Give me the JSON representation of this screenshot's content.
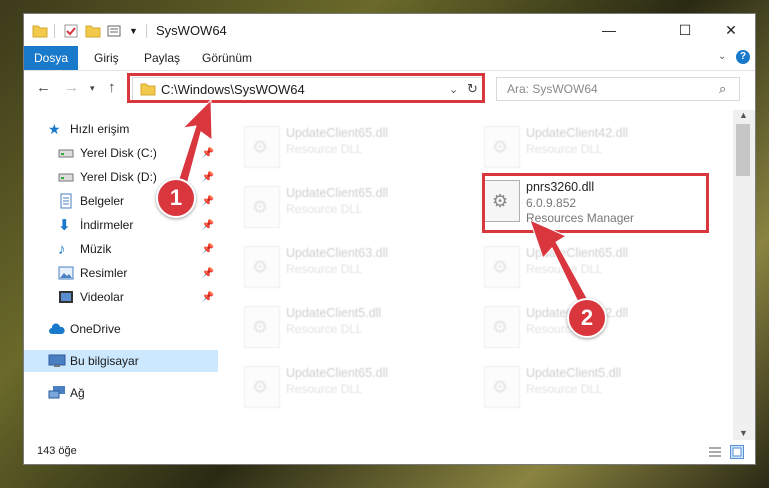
{
  "window": {
    "title": "SysWOW64",
    "controls": {
      "minimize": "—",
      "maximize": "☐",
      "close": "✕"
    }
  },
  "ribbon": {
    "tabs": [
      {
        "label": "Dosya",
        "active": true
      },
      {
        "label": "Giriş"
      },
      {
        "label": "Paylaş"
      },
      {
        "label": "Görünüm"
      }
    ]
  },
  "address": {
    "path": "C:\\Windows\\SysWOW64",
    "search_placeholder": "Ara: SysWOW64"
  },
  "navpane": {
    "items": [
      {
        "label": "Hızlı erişim",
        "icon": "star-icon"
      },
      {
        "label": "Yerel Disk (C:)",
        "icon": "drive-icon",
        "pinned": true
      },
      {
        "label": "Yerel Disk (D:)",
        "icon": "drive-icon",
        "pinned": true
      },
      {
        "label": "Belgeler",
        "icon": "documents-icon",
        "pinned": true
      },
      {
        "label": "İndirmeler",
        "icon": "download-icon",
        "pinned": true
      },
      {
        "label": "Müzik",
        "icon": "music-icon",
        "pinned": true
      },
      {
        "label": "Resimler",
        "icon": "pictures-icon",
        "pinned": true
      },
      {
        "label": "Videolar",
        "icon": "videos-icon",
        "pinned": true
      },
      {
        "label": "OneDrive",
        "icon": "cloud-icon"
      },
      {
        "label": "Bu bilgisayar",
        "icon": "computer-icon",
        "selected": true
      },
      {
        "label": "Ağ",
        "icon": "network-icon"
      }
    ]
  },
  "files": [
    {
      "name": "UpdateClient65.dll",
      "sub1": "Resource DLL",
      "faded": true
    },
    {
      "name": "UpdateClient42.dll",
      "sub1": "Resource DLL",
      "faded": true
    },
    {
      "name": "UpdateClient65.dll",
      "sub1": "Resource DLL",
      "faded": true
    },
    {
      "name": "pnrs3260.dll",
      "sub1": "6.0.9.852",
      "sub2": "Resources Manager",
      "faded": false
    },
    {
      "name": "UpdateClient63.dll",
      "sub1": "Resource DLL",
      "faded": true
    },
    {
      "name": "UpdateClient65.dll",
      "sub1": "Resource DLL",
      "faded": true
    },
    {
      "name": "UpdateClient5.dll",
      "sub1": "Resource DLL",
      "faded": true
    },
    {
      "name": "UpdateClient42.dll",
      "sub1": "Resource DLL",
      "faded": true
    },
    {
      "name": "UpdateClient65.dll",
      "sub1": "Resource DLL",
      "faded": true
    },
    {
      "name": "UpdateClient5.dll",
      "sub1": "Resource DLL",
      "faded": true
    }
  ],
  "status": {
    "count": "143 öğe"
  },
  "annotations": {
    "badge1": "1",
    "badge2": "2",
    "color": "#d9363e"
  },
  "colors": {
    "accent": "#1979ca",
    "selection": "#cce8ff"
  }
}
